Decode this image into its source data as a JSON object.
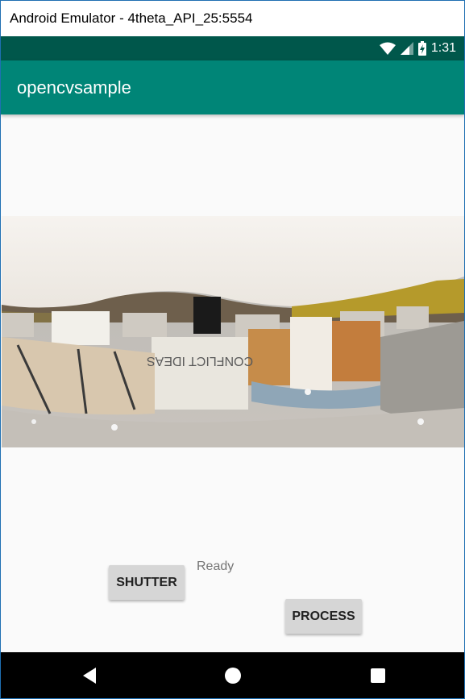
{
  "window": {
    "title": "Android Emulator - 4theta_API_25:5554"
  },
  "status_bar": {
    "time": "1:31",
    "icons": [
      "wifi-icon",
      "signal-icon",
      "battery-icon"
    ],
    "color": "#00574b"
  },
  "app_bar": {
    "title": "opencvsample",
    "color": "#008577"
  },
  "main": {
    "status_text": "Ready",
    "shutter_label": "SHUTTER",
    "process_label": "PROCESS",
    "image_description_icon": "panorama-image",
    "image_sign_text": "CONFLICT IDEAS"
  },
  "nav_bar": {
    "back_icon": "back-triangle-icon",
    "home_icon": "home-circle-icon",
    "recents_icon": "recents-square-icon"
  }
}
